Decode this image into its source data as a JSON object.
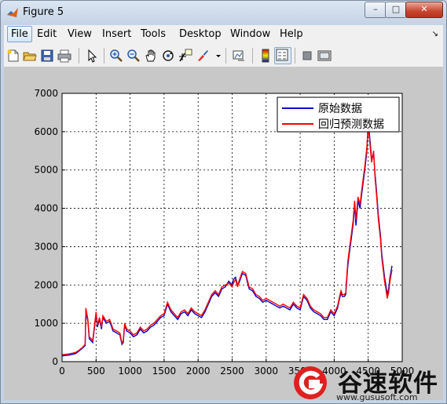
{
  "window": {
    "title": "Figure 5",
    "minimize": "–",
    "maximize": "□",
    "close": "✕"
  },
  "menu": {
    "items": [
      "File",
      "Edit",
      "View",
      "Insert",
      "Tools",
      "Desktop",
      "Window",
      "Help"
    ],
    "overflow": "↘"
  },
  "toolbar": {
    "buttons": [
      "new-figure-icon",
      "open-file-icon",
      "save-icon",
      "print-icon",
      "edit-plot-icon",
      "zoom-in-icon",
      "zoom-out-icon",
      "pan-icon",
      "rotate-3d-icon",
      "data-cursor-icon",
      "brush-icon",
      "link-plot-icon",
      "insert-colorbar-icon",
      "insert-legend-icon",
      "hide-plot-tools-icon",
      "show-plot-tools-icon"
    ],
    "pressed": "insert-legend-icon"
  },
  "chart_data": {
    "type": "line",
    "xlim": [
      0,
      500
    ],
    "ylim": [
      0,
      7000
    ],
    "xticks": [
      0,
      50,
      100,
      150,
      200,
      250,
      300,
      350,
      400,
      450,
      500
    ],
    "xtick_labels": [
      "0",
      "500",
      "1000",
      "1500",
      "2000",
      "2500",
      "3000",
      "3500",
      "4000",
      "4500",
      "5000"
    ],
    "yticks": [
      0,
      1000,
      2000,
      3000,
      4000,
      5000,
      6000,
      7000
    ],
    "grid": true,
    "legend_position": "top-right",
    "series": [
      {
        "name": "原始数据",
        "color": "#0000cc",
        "x": [
          0,
          10,
          20,
          25,
          30,
          34,
          35,
          38,
          40,
          45,
          48,
          50,
          52,
          55,
          58,
          60,
          65,
          70,
          75,
          80,
          85,
          88,
          90,
          92,
          95,
          100,
          105,
          110,
          115,
          120,
          125,
          130,
          135,
          140,
          145,
          150,
          155,
          160,
          165,
          170,
          175,
          180,
          185,
          190,
          195,
          200,
          205,
          210,
          215,
          220,
          225,
          230,
          235,
          240,
          245,
          250,
          252,
          255,
          258,
          260,
          265,
          270,
          272,
          275,
          280,
          285,
          290,
          295,
          300,
          305,
          310,
          315,
          320,
          325,
          330,
          335,
          340,
          345,
          350,
          355,
          360,
          365,
          370,
          375,
          380,
          385,
          390,
          395,
          400,
          405,
          408,
          410,
          412,
          415,
          417,
          418,
          420,
          422,
          425,
          428,
          430,
          432,
          435,
          438,
          440,
          442,
          445,
          448,
          450,
          452,
          455,
          458,
          460,
          462,
          465,
          468,
          470,
          472,
          474,
          476,
          478,
          480,
          482,
          485
        ],
        "y": [
          150,
          170,
          210,
          280,
          350,
          420,
          1300,
          1050,
          600,
          500,
          950,
          1250,
          900,
          1100,
          850,
          1150,
          1000,
          1050,
          800,
          750,
          700,
          450,
          500,
          950,
          800,
          750,
          650,
          700,
          850,
          750,
          800,
          900,
          950,
          1050,
          1150,
          1200,
          1500,
          1300,
          1200,
          1100,
          1250,
          1300,
          1200,
          1350,
          1250,
          1200,
          1150,
          1300,
          1500,
          1700,
          1800,
          1700,
          1900,
          1950,
          2100,
          2000,
          2150,
          2200,
          2000,
          2050,
          2300,
          2250,
          2100,
          1900,
          1850,
          1700,
          1650,
          1550,
          1600,
          1550,
          1500,
          1450,
          1400,
          1450,
          1400,
          1350,
          1500,
          1400,
          1350,
          1700,
          1600,
          1400,
          1300,
          1250,
          1200,
          1100,
          1100,
          1300,
          1200,
          1400,
          1650,
          1800,
          1700,
          1700,
          1750,
          2000,
          2500,
          2800,
          3200,
          3600,
          4100,
          3550,
          4200,
          4000,
          4300,
          4600,
          5000,
          5500,
          6300,
          5900,
          5300,
          5400,
          4900,
          4500,
          3800,
          3300,
          2800,
          2500,
          2200,
          2000,
          1750,
          1900,
          2200,
          2500
        ]
      },
      {
        "name": "回归预测数据",
        "color": "#ff0000",
        "x": [
          0,
          10,
          20,
          25,
          30,
          34,
          35,
          38,
          40,
          45,
          48,
          50,
          52,
          55,
          58,
          60,
          65,
          70,
          75,
          80,
          85,
          88,
          90,
          92,
          95,
          100,
          105,
          110,
          115,
          120,
          125,
          130,
          135,
          140,
          145,
          150,
          155,
          160,
          165,
          170,
          175,
          180,
          185,
          190,
          195,
          200,
          205,
          210,
          215,
          220,
          225,
          230,
          235,
          240,
          245,
          250,
          252,
          255,
          258,
          260,
          265,
          270,
          272,
          275,
          280,
          285,
          290,
          295,
          300,
          305,
          310,
          315,
          320,
          325,
          330,
          335,
          340,
          345,
          350,
          355,
          360,
          365,
          370,
          375,
          380,
          385,
          390,
          395,
          400,
          405,
          408,
          410,
          412,
          415,
          417,
          418,
          420,
          422,
          425,
          428,
          430,
          432,
          435,
          438,
          440,
          442,
          445,
          448,
          450,
          452,
          455,
          458,
          460,
          462,
          465,
          468,
          470,
          472,
          474,
          476,
          478,
          480,
          482,
          485
        ],
        "y": [
          180,
          200,
          240,
          300,
          370,
          450,
          1400,
          1100,
          650,
          550,
          1000,
          1300,
          950,
          1150,
          900,
          1200,
          1050,
          1100,
          850,
          800,
          750,
          480,
          550,
          1000,
          850,
          800,
          700,
          750,
          900,
          800,
          850,
          950,
          1000,
          1100,
          1200,
          1250,
          1550,
          1350,
          1250,
          1150,
          1300,
          1350,
          1250,
          1400,
          1300,
          1250,
          1200,
          1350,
          1550,
          1750,
          1850,
          1750,
          1950,
          2000,
          2050,
          1950,
          2050,
          2150,
          1950,
          2100,
          2350,
          2300,
          2150,
          1950,
          1900,
          1750,
          1700,
          1600,
          1650,
          1600,
          1550,
          1500,
          1450,
          1500,
          1450,
          1400,
          1550,
          1450,
          1400,
          1750,
          1650,
          1450,
          1350,
          1300,
          1250,
          1150,
          1150,
          1350,
          1250,
          1450,
          1700,
          1850,
          1750,
          1750,
          1800,
          2100,
          2600,
          2900,
          3300,
          3700,
          4200,
          3700,
          4300,
          4100,
          4400,
          4700,
          5100,
          5600,
          6100,
          5800,
          5200,
          5500,
          4800,
          4400,
          3700,
          3200,
          2700,
          2400,
          2100,
          1900,
          1650,
          1800,
          2100,
          2400
        ]
      }
    ]
  },
  "watermark": {
    "title": "谷速软件",
    "url": "www.gususoft.com"
  }
}
